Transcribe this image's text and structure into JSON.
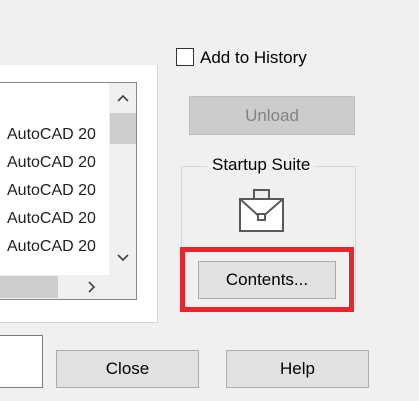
{
  "history_checkbox": {
    "label": "Add to History",
    "checked": false
  },
  "buttons": {
    "unload": "Unload",
    "contents": "Contents...",
    "close": "Close",
    "help": "Help"
  },
  "startup_suite": {
    "title": "Startup Suite",
    "icon": "briefcase-icon"
  },
  "list": {
    "items": [
      "AutoCAD 20",
      "AutoCAD 20",
      "AutoCAD 20",
      "AutoCAD 20",
      "AutoCAD 20"
    ]
  },
  "colors": {
    "highlight": "#e8242c"
  }
}
